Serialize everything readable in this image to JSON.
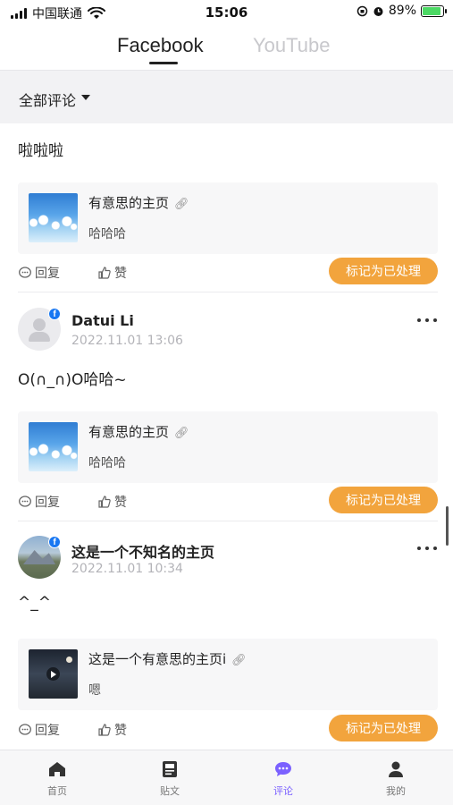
{
  "status_bar": {
    "carrier": "中国联通",
    "time": "15:06",
    "battery": "89%",
    "battery_level": 0.89
  },
  "platform_tabs": [
    {
      "label": "Facebook",
      "active": true
    },
    {
      "label": "YouTube",
      "active": false
    }
  ],
  "filter": {
    "label": "全部评论"
  },
  "comments": [
    {
      "text": "啦啦啦",
      "post": {
        "title": "有意思的主页",
        "subtitle": "哈哈哈"
      },
      "actions": {
        "reply": "回复",
        "like": "赞",
        "mark": "标记为已处理"
      }
    },
    {
      "author": "Datui Li",
      "time": "2022.11.01 13:06",
      "text": "O(∩_∩)O哈哈~",
      "post": {
        "title": "有意思的主页",
        "subtitle": "哈哈哈"
      },
      "actions": {
        "reply": "回复",
        "like": "赞",
        "mark": "标记为已处理"
      }
    },
    {
      "author": "这是一个不知名的主页",
      "time": "2022.11.01 10:34",
      "text": "^_^",
      "post": {
        "title": "这是一个有意思的主页i",
        "subtitle": "嗯"
      },
      "actions": {
        "reply": "回复",
        "like": "赞",
        "mark": "标记为已处理"
      }
    }
  ],
  "bottom_nav": [
    {
      "label": "首页",
      "icon": "home-icon",
      "active": false
    },
    {
      "label": "贴文",
      "icon": "post-icon",
      "active": false
    },
    {
      "label": "评论",
      "icon": "comment-icon",
      "active": true
    },
    {
      "label": "我的",
      "icon": "profile-icon",
      "active": false
    }
  ],
  "colors": {
    "accent": "#7b61ff",
    "mark_button": "#f2a43d",
    "facebook_badge": "#1877f2"
  }
}
